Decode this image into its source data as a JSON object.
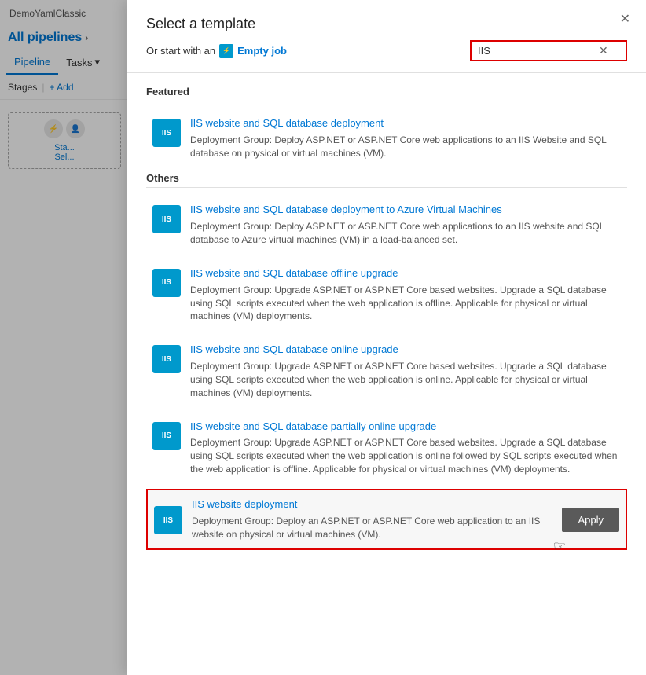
{
  "sidebar": {
    "app_title": "DemoYamlClassic",
    "breadcrumb": "All pipelines",
    "breadcrumb_arrow": "›",
    "tabs": [
      {
        "label": "Pipeline",
        "active": true
      },
      {
        "label": "Tasks",
        "active": false,
        "has_arrow": true
      }
    ],
    "stages_label": "Stages",
    "add_label": "+ Add",
    "stage_card": {
      "text1": "Sta...",
      "text2": "Sel..."
    }
  },
  "modal": {
    "close_label": "✕",
    "title": "Select a template",
    "subtitle": "Or start with an",
    "empty_job_icon": "⚡",
    "empty_job_label": "Empty job",
    "search_value": "IIS",
    "search_clear": "✕",
    "sections": [
      {
        "label": "Featured",
        "items": [
          {
            "badge": "IIS",
            "name": "IIS website and SQL database deployment",
            "desc": "Deployment Group: Deploy ASP.NET or ASP.NET Core web applications to an IIS Website and SQL database on physical or virtual machines (VM)."
          }
        ]
      },
      {
        "label": "Others",
        "items": [
          {
            "badge": "IIS",
            "name": "IIS website and SQL database deployment to Azure Virtual Machines",
            "desc": "Deployment Group: Deploy ASP.NET or ASP.NET Core web applications to an IIS website and SQL database to Azure virtual machines (VM) in a load-balanced set."
          },
          {
            "badge": "IIS",
            "name": "IIS website and SQL database offline upgrade",
            "desc": "Deployment Group: Upgrade ASP.NET or ASP.NET Core based websites. Upgrade a SQL database using SQL scripts executed when the web application is offline. Applicable for physical or virtual machines (VM) deployments."
          },
          {
            "badge": "IIS",
            "name": "IIS website and SQL database online upgrade",
            "desc": "Deployment Group: Upgrade ASP.NET or ASP.NET Core based websites. Upgrade a SQL database using SQL scripts executed when the web application is online. Applicable for physical or virtual machines (VM) deployments."
          },
          {
            "badge": "IIS",
            "name": "IIS website and SQL database partially online upgrade",
            "desc": "Deployment Group: Upgrade ASP.NET or ASP.NET Core based websites. Upgrade a SQL database using SQL scripts executed when the web application is online followed by SQL scripts executed when the web application is offline. Applicable for physical or virtual machines (VM) deployments."
          }
        ]
      }
    ],
    "selected_item": {
      "badge": "IIS",
      "name": "IIS website deployment",
      "desc": "Deployment Group: Deploy an ASP.NET or ASP.NET Core web application to an IIS website on physical or virtual machines (VM).",
      "apply_label": "Apply"
    }
  }
}
